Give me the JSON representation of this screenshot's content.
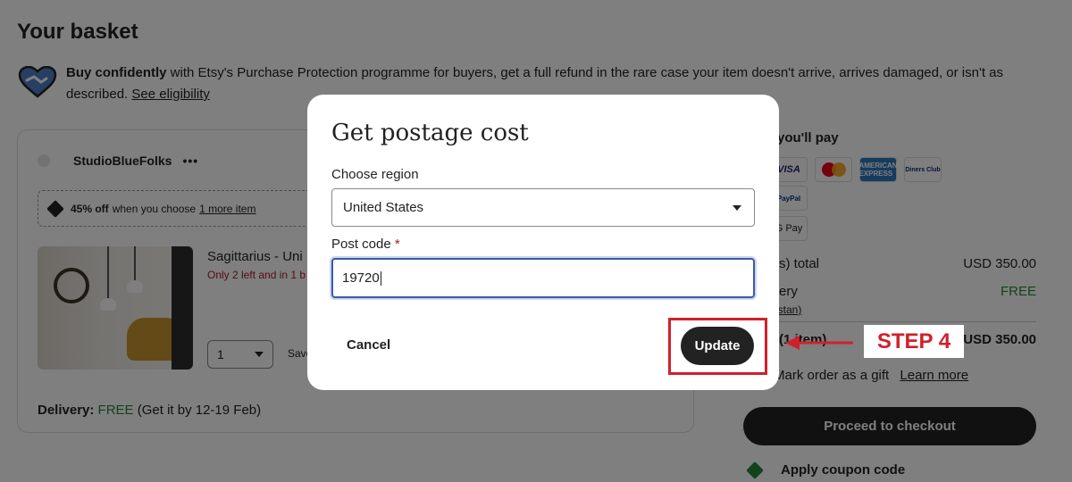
{
  "page": {
    "title": "Your basket",
    "protection": {
      "bold": "Buy confidently",
      "text": " with Etsy's Purchase Protection programme for buyers, get a full refund in the rare case your item doesn't arrive, arrives damaged, or isn't as described. ",
      "link": "See eligibility"
    }
  },
  "cart": {
    "shop_name": "StudioBlueFolks",
    "more_icon": "•••",
    "promo": {
      "bold": "45% off",
      "text": "when you choose",
      "link": "1 more item"
    },
    "item": {
      "title": "Sagittarius - Uni",
      "stock": "Only 2 left and in 1 b",
      "qty": "1",
      "save_label": "Save"
    },
    "delivery": {
      "label": "Delivery:",
      "free": "FREE",
      "eta": "(Get it by 12-19 Feb)"
    }
  },
  "sidebar": {
    "pay_heading": "you'll pay",
    "cards": {
      "visa": "VISA",
      "amex": "AMERICAN EXPRESS",
      "diners": "Diners Club",
      "paypal": "PayPal",
      "gpay": "G Pay"
    },
    "items_total_label": "s) total",
    "items_total_value": "USD 350.00",
    "delivery_label": "ery",
    "delivery_value": "FREE",
    "delivery_sub": "istan)",
    "total_label": "(1 item)",
    "total_value": "USD 350.00",
    "gift_label": "Mark order as a gift",
    "gift_link": "Learn more",
    "checkout_label": "Proceed to checkout",
    "coupon_label": "Apply coupon code"
  },
  "modal": {
    "title": "Get postage cost",
    "region_label": "Choose region",
    "region_value": "United States",
    "postcode_label": "Post code",
    "postcode_required": "*",
    "postcode_value": "19720",
    "cancel_label": "Cancel",
    "update_label": "Update"
  },
  "annotation": {
    "step_label": "STEP 4",
    "color": "#d0202c"
  }
}
